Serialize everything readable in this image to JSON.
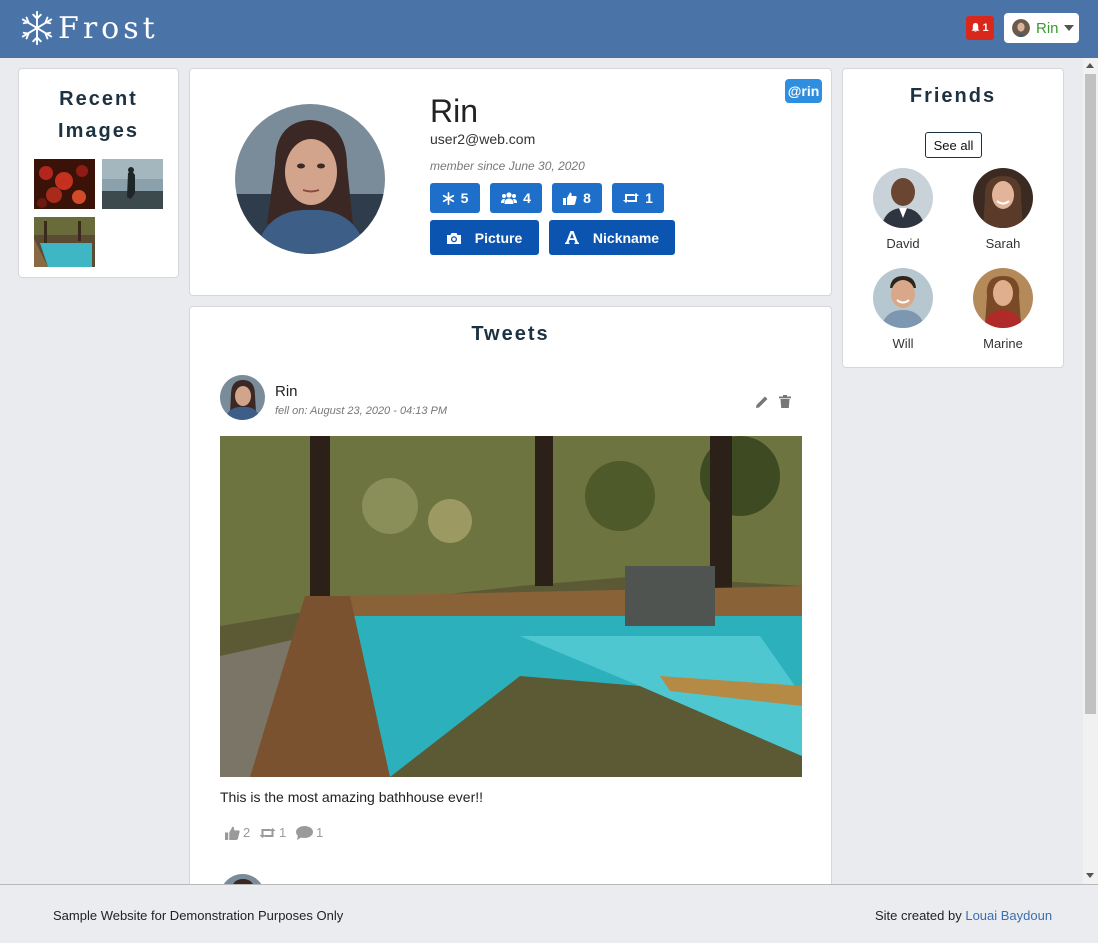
{
  "app": {
    "brand": "Frost"
  },
  "navbar": {
    "notification_count": "1",
    "user_name": "Rin"
  },
  "sidebar_left": {
    "title": "Recent Images"
  },
  "profile": {
    "name": "Rin",
    "handle": "@rin",
    "email": "user2@web.com",
    "member_since": "member since June 30, 2020",
    "stats": [
      {
        "icon": "snowflake-icon",
        "value": "5"
      },
      {
        "icon": "friends-icon",
        "value": "4"
      },
      {
        "icon": "thumbs-up-icon",
        "value": "8"
      },
      {
        "icon": "retweet-icon",
        "value": "1"
      }
    ],
    "actions": {
      "picture": "Picture",
      "nickname": "Nickname"
    }
  },
  "tweets": {
    "title": "Tweets",
    "items": [
      {
        "author": "Rin",
        "date": "fell on: August 23, 2020 - 04:13 PM",
        "text": "This is the most amazing bathhouse ever!!",
        "likes": "2",
        "retweets": "1",
        "comments": "1"
      }
    ]
  },
  "friends": {
    "title": "Friends",
    "see_all": "See all",
    "items": [
      {
        "name": "David"
      },
      {
        "name": "Sarah"
      },
      {
        "name": "Will"
      },
      {
        "name": "Marine"
      }
    ]
  },
  "footer": {
    "left": "Sample Website for Demonstration Purposes Only",
    "right_prefix": "Site created by",
    "right_link": "Louai Baydoun"
  },
  "colors": {
    "navbar": "#4a74a8",
    "stat_button": "#1e6fc9",
    "action_button": "#0b54b0",
    "notification": "#d9271c",
    "handle_badge": "#2e8ee0"
  }
}
